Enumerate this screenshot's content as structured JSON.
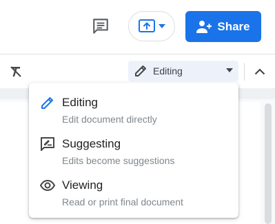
{
  "header": {
    "share_label": "Share",
    "icons": [
      "comment-icon",
      "present-icon",
      "chevron-down-icon",
      "person-add-icon"
    ]
  },
  "toolbar": {
    "mode_label": "Editing",
    "icons": [
      "clear-formatting-icon",
      "pencil-icon",
      "caret-down-icon",
      "chevron-up-icon"
    ]
  },
  "mode_menu": {
    "items": [
      {
        "title": "Editing",
        "description": "Edit document directly",
        "icon": "pencil-icon",
        "selected": true
      },
      {
        "title": "Suggesting",
        "description": "Edits become suggestions",
        "icon": "suggest-edit-icon",
        "selected": false
      },
      {
        "title": "Viewing",
        "description": "Read or print final document",
        "icon": "eye-icon",
        "selected": false
      }
    ]
  },
  "colors": {
    "accent": "#1a73e8",
    "selected_icon": "#1a73e8",
    "icon": "#5f6368",
    "mode_select_bg": "#edf2fa"
  }
}
